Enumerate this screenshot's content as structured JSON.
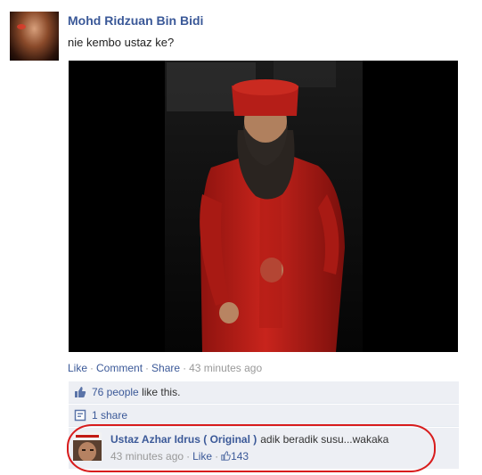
{
  "post": {
    "author": "Mohd Ridzuan Bin Bidi",
    "message": "nie kembo ustaz ke?"
  },
  "actions": {
    "like": "Like",
    "comment": "Comment",
    "share": "Share",
    "timestamp": "43 minutes ago"
  },
  "likes": {
    "count_link": "76 people",
    "suffix": "like this."
  },
  "shares": {
    "label": "1 share"
  },
  "comment": {
    "author": "Ustaz Azhar Idrus ( Original )",
    "text": "adik beradik susu...wakaka",
    "timestamp": "43 minutes ago",
    "like": "Like",
    "like_count": "143"
  },
  "colors": {
    "link": "#3b5998",
    "ufi_background": "#edeff4",
    "highlight_oval": "#d81c1c",
    "robe": "#c8241c"
  }
}
